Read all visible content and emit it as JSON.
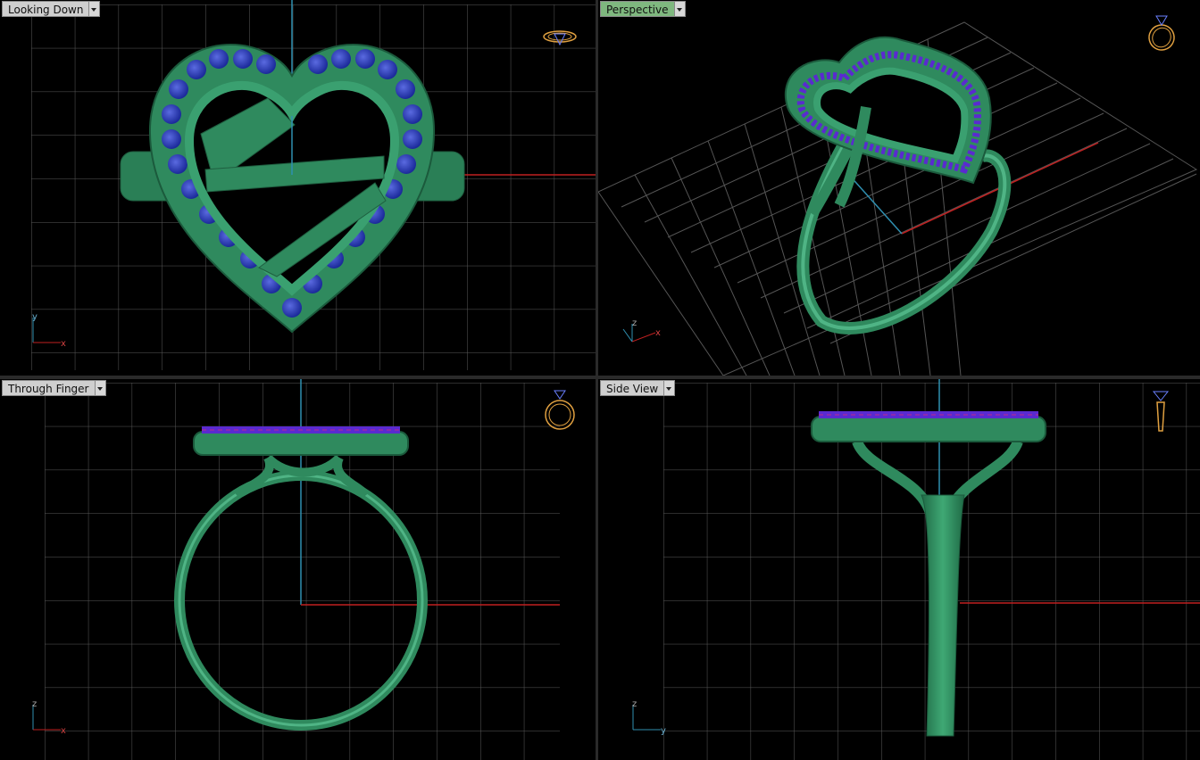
{
  "viewports": [
    {
      "id": "top-left",
      "label": "Looking Down",
      "axis": [
        "y",
        "x"
      ]
    },
    {
      "id": "top-right",
      "label": "Perspective",
      "axis": [
        "z",
        "x"
      ]
    },
    {
      "id": "bottom-left",
      "label": "Through Finger",
      "axis": [
        "z",
        "x"
      ]
    },
    {
      "id": "bottom-right",
      "label": "Side View",
      "axis": [
        "z",
        "y"
      ]
    }
  ],
  "colors": {
    "metal": "#2f8a5e",
    "metal_light": "#4fb485",
    "gem_blue": "#2a3fbf",
    "prong_purple": "#8a2ab0",
    "grid": "#5a5a5a",
    "axis_red": "#c02020",
    "axis_blue": "#2f8fb0",
    "active_tab": "#7fb87f",
    "icon_orange": "#e0a040"
  },
  "icons": [
    "ring-top-icon",
    "ring-perspective-icon",
    "ring-front-icon",
    "ring-side-icon"
  ]
}
